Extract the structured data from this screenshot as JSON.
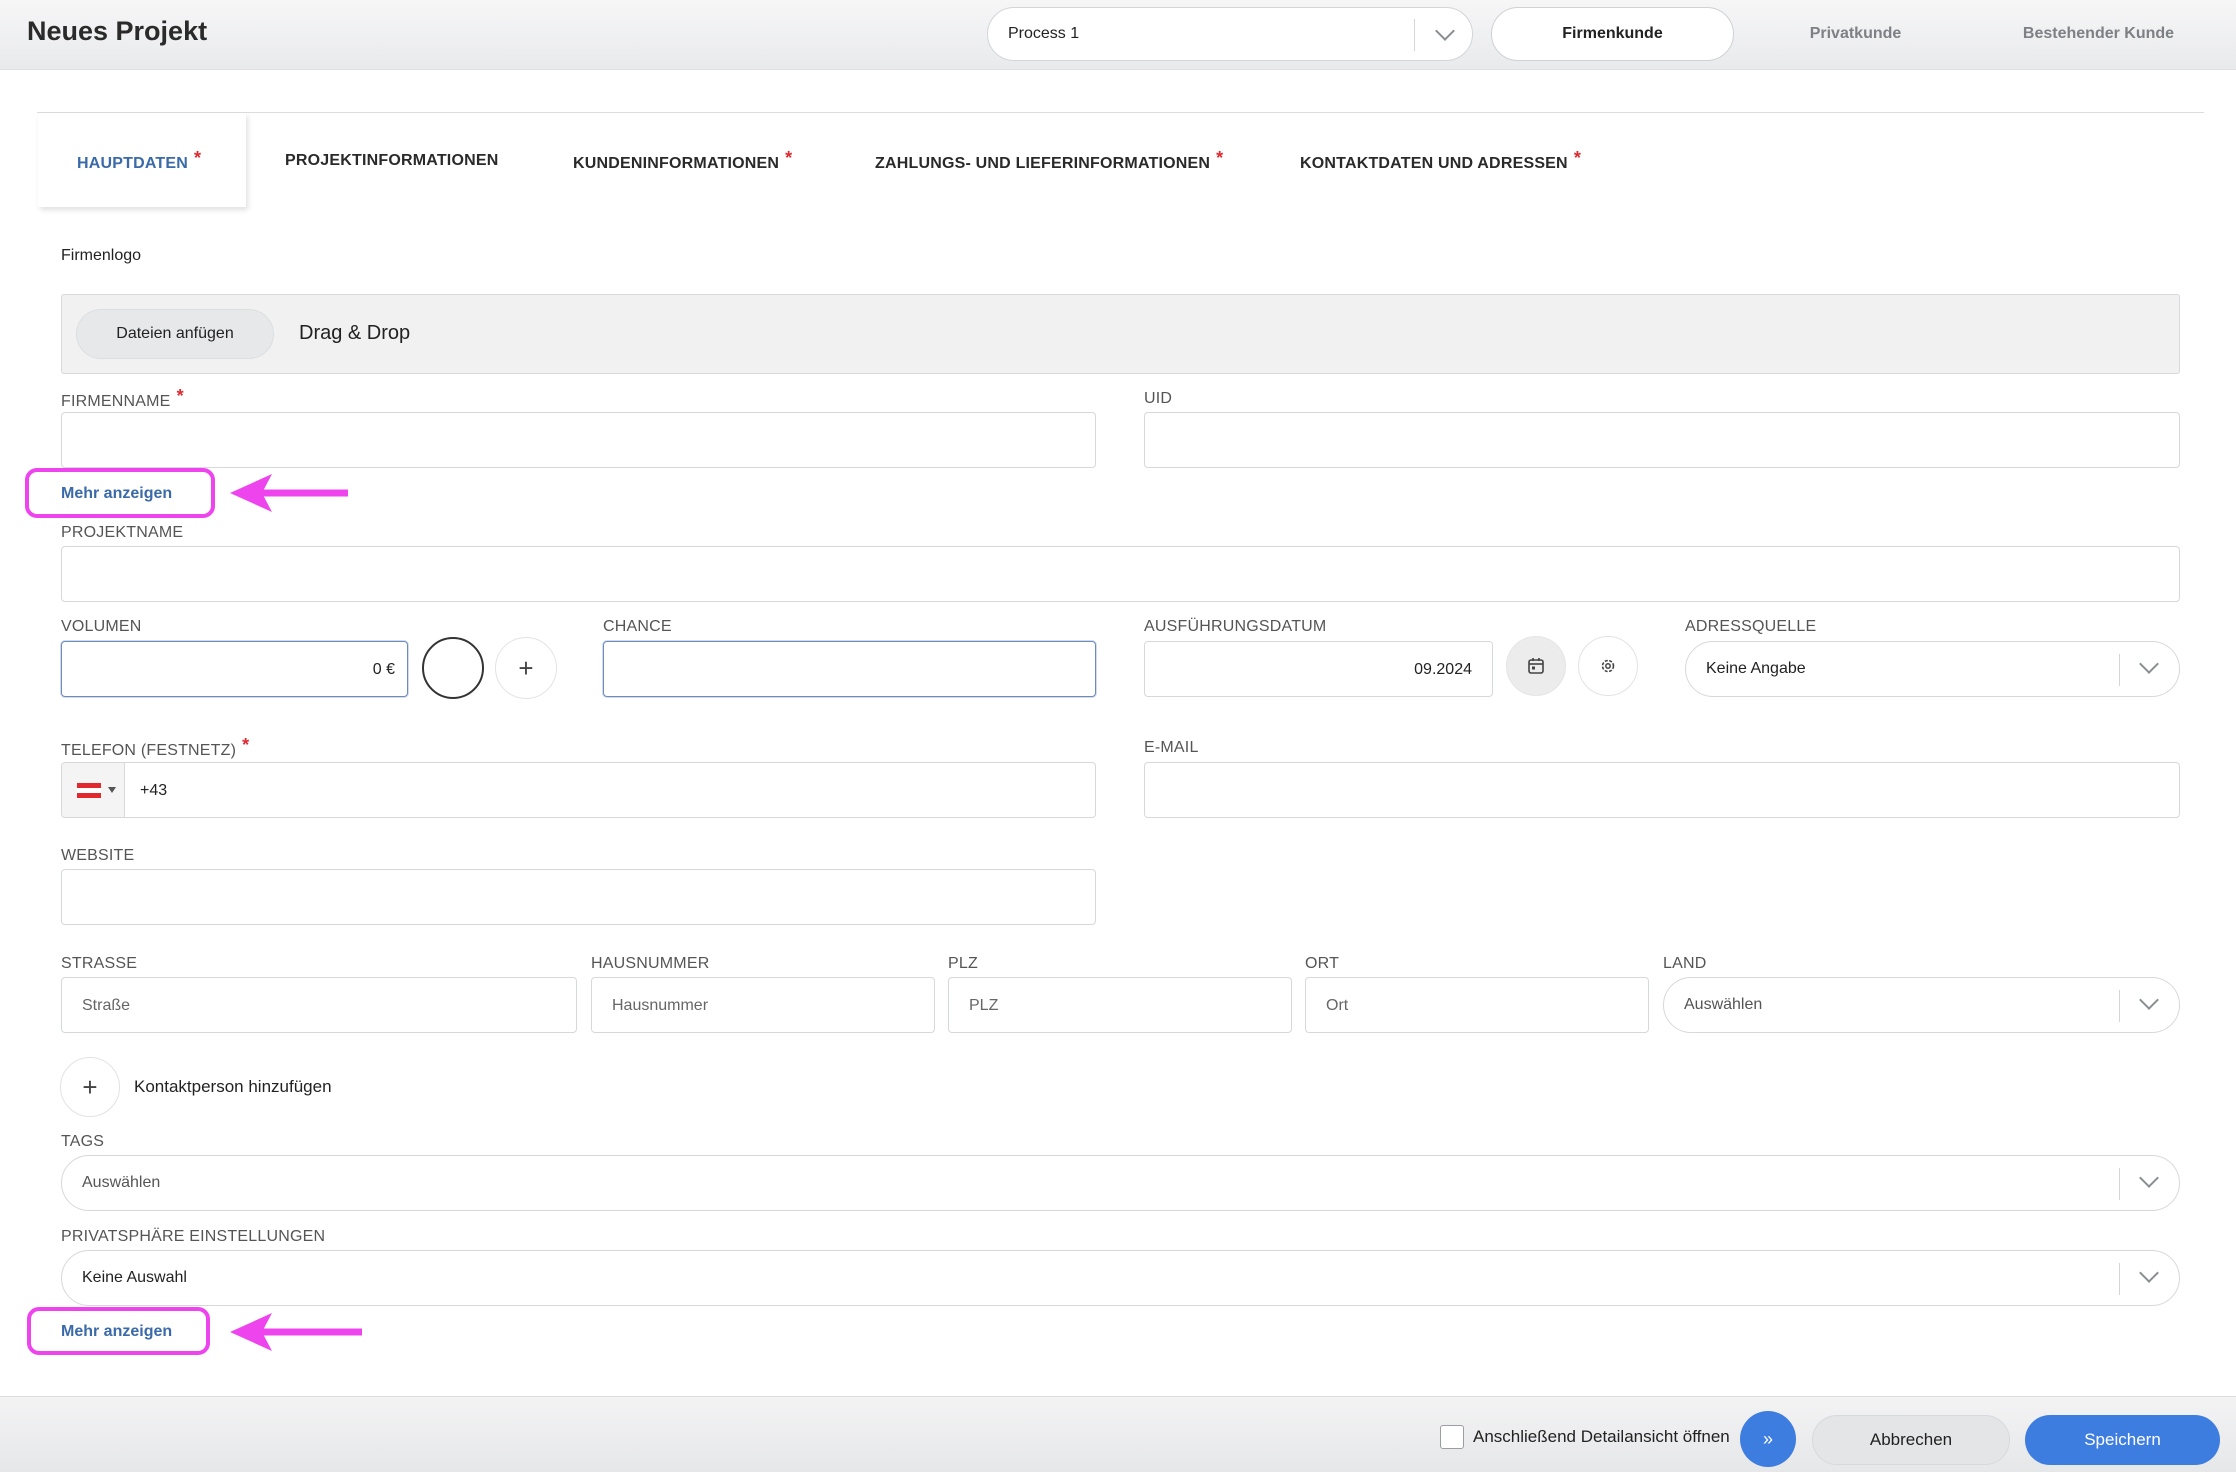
{
  "header": {
    "title": "Neues Projekt",
    "process_value": "Process 1",
    "segments": [
      "Firmenkunde",
      "Privatkunde",
      "Bestehender Kunde"
    ],
    "active_segment": "Firmenkunde"
  },
  "tabs": [
    {
      "label": "HAUPTDATEN",
      "required": "*"
    },
    {
      "label": "PROJEKTINFORMATIONEN",
      "required": ""
    },
    {
      "label": "KUNDENINFORMATIONEN",
      "required": "*"
    },
    {
      "label": "ZAHLUNGS- UND LIEFERINFORMATIONEN",
      "required": "*"
    },
    {
      "label": "KONTAKTDATEN UND ADRESSEN",
      "required": "*"
    }
  ],
  "logo": {
    "label": "Firmenlogo",
    "button": "Dateien anfügen",
    "drop_text": "Drag & Drop"
  },
  "fields": {
    "firmenname": {
      "label": "FIRMENNAME",
      "required": "*",
      "value": ""
    },
    "uid": {
      "label": "UID",
      "value": ""
    },
    "more_link": "Mehr anzeigen",
    "projektname": {
      "label": "PROJEKTNAME",
      "value": ""
    },
    "volumen": {
      "label": "VOLUMEN",
      "value": "0 €"
    },
    "chance": {
      "label": "CHANCE",
      "value": ""
    },
    "ausfuehrungsdatum": {
      "label": "AUSFÜHRUNGSDATUM",
      "value": "09.2024"
    },
    "adressquelle": {
      "label": "ADRESSQUELLE",
      "value": "Keine Angabe"
    },
    "telefon": {
      "label": "TELEFON (FESTNETZ)",
      "required": "*",
      "prefix": "+43"
    },
    "email": {
      "label": "E-MAIL",
      "value": ""
    },
    "website": {
      "label": "WEBSITE",
      "value": ""
    },
    "strasse": {
      "label": "STRASSE",
      "placeholder": "Straße"
    },
    "hausnummer": {
      "label": "HAUSNUMMER",
      "placeholder": "Hausnummer"
    },
    "plz": {
      "label": "PLZ",
      "placeholder": "PLZ"
    },
    "ort": {
      "label": "ORT",
      "placeholder": "Ort"
    },
    "land": {
      "label": "LAND",
      "placeholder": "Auswählen"
    },
    "kontakt": "Kontaktperson hinzufügen",
    "tags": {
      "label": "TAGS",
      "placeholder": "Auswählen"
    },
    "privatsphaere": {
      "label": "PRIVATSPHÄRE EINSTELLUNGEN",
      "value": "Keine Auswahl"
    },
    "more_link_2": "Mehr anzeigen"
  },
  "footer": {
    "checkbox_label": "Anschließend Detailansicht öffnen",
    "cancel": "Abbrechen",
    "save": "Speichern"
  },
  "colors": {
    "accent": "#3d7de0",
    "link": "#3a6aa8",
    "required": "#e0282e",
    "highlight": "#ee44ee"
  }
}
